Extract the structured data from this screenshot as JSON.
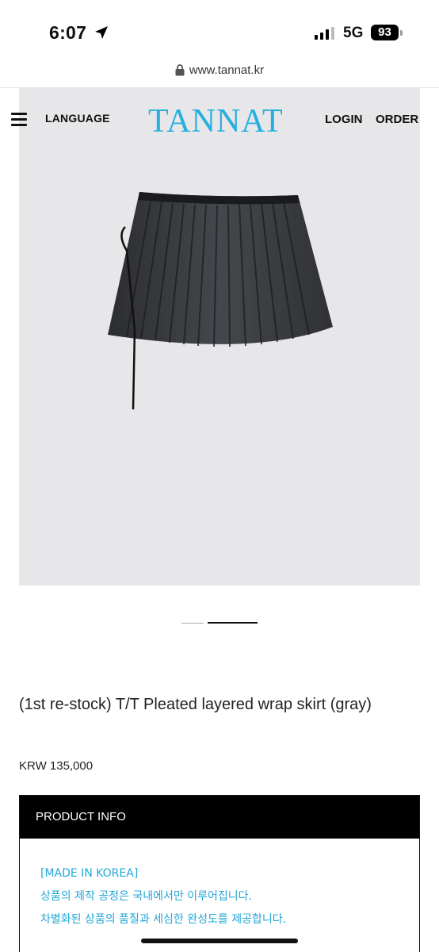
{
  "status_bar": {
    "time": "6:07",
    "network": "5G",
    "battery": "93"
  },
  "browser": {
    "url": "www.tannat.kr"
  },
  "header": {
    "language": "LANGUAGE",
    "logo": "TANNAT",
    "login": "LOGIN",
    "order": "ORDER"
  },
  "product": {
    "title": "(1st re-stock) T/T Pleated layered wrap skirt (gray)",
    "price": "KRW 135,000"
  },
  "info": {
    "header": "PRODUCT INFO",
    "lines": [
      "[MADE IN KOREA]",
      "상품의 제작 공정은 국내에서만 이루어집니다.",
      "차별화된 상품의 품질과 세심한 완성도를 제공합니다."
    ]
  },
  "colors": {
    "brand": "#27aee0",
    "info_text": "#22a7d8",
    "image_bg": "#e7e7e9"
  }
}
